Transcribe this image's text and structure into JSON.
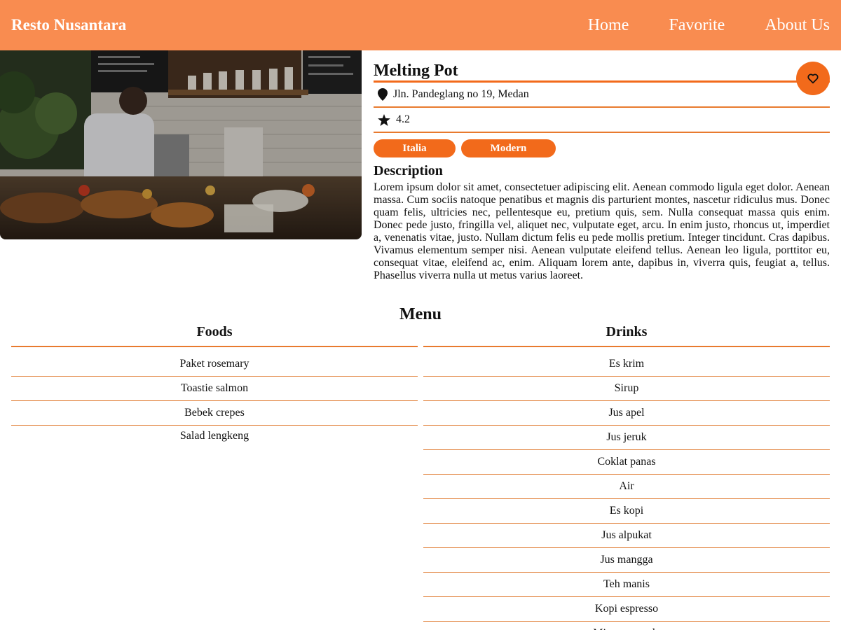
{
  "header": {
    "brand": "Resto Nusantara",
    "nav": [
      {
        "label": "Home"
      },
      {
        "label": "Favorite"
      },
      {
        "label": "About Us"
      }
    ]
  },
  "restaurant": {
    "name": "Melting Pot",
    "address": "Jln. Pandeglang no 19, Medan",
    "rating": "4.2",
    "categories": [
      "Italia",
      "Modern"
    ],
    "description_title": "Description",
    "description": "Lorem ipsum dolor sit amet, consectetuer adipiscing elit. Aenean commodo ligula eget dolor. Aenean massa. Cum sociis natoque penatibus et magnis dis parturient montes, nascetur ridiculus mus. Donec quam felis, ultricies nec, pellentesque eu, pretium quis, sem. Nulla consequat massa quis enim. Donec pede justo, fringilla vel, aliquet nec, vulputate eget, arcu. In enim justo, rhoncus ut, imperdiet a, venenatis vitae, justo. Nullam dictum felis eu pede mollis pretium. Integer tincidunt. Cras dapibus. Vivamus elementum semper nisi. Aenean vulputate eleifend tellus. Aenean leo ligula, porttitor eu, consequat vitae, eleifend ac, enim. Aliquam lorem ante, dapibus in, viverra quis, feugiat a, tellus. Phasellus viverra nulla ut metus varius laoreet.",
    "hero_image_icon": "restaurant-kitchen-photo"
  },
  "menu": {
    "title": "Menu",
    "foods": {
      "title": "Foods",
      "items": [
        "Paket rosemary",
        "Toastie salmon",
        "Bebek crepes",
        "Salad lengkeng"
      ]
    },
    "drinks": {
      "title": "Drinks",
      "items": [
        "Es krim",
        "Sirup",
        "Jus apel",
        "Jus jeruk",
        "Coklat panas",
        "Air",
        "Es kopi",
        "Jus alpukat",
        "Jus mangga",
        "Teh manis",
        "Kopi espresso",
        "Minuman soda"
      ]
    }
  },
  "colors": {
    "header_bg": "#f98c50",
    "accent": "#f26a1b",
    "divider": "#e87a2e"
  },
  "icons": {
    "favorite": "heart-outline-icon",
    "address": "map-pin-icon",
    "rating": "star-icon"
  }
}
